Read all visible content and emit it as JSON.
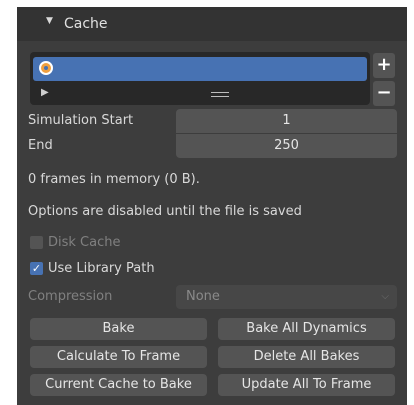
{
  "panel": {
    "title": "Cache",
    "expanded_icon": "▼"
  },
  "cache_list": {
    "selected_item_label": "",
    "item_icon": "point-cache-icon",
    "play_icon": "▶",
    "add_label": "+",
    "remove_label": "−"
  },
  "simulation": {
    "start_label": "Simulation Start",
    "start_value": "1",
    "end_label": "End",
    "end_value": "250"
  },
  "info": {
    "frames_text": "0 frames in memory (0 B).",
    "options_text": "Options are disabled until the file is saved"
  },
  "options": {
    "disk_cache_label": "Disk Cache",
    "disk_cache_checked": false,
    "use_library_path_label": "Use Library Path",
    "use_library_path_checked": true,
    "check_mark": "✓",
    "compression_label": "Compression",
    "compression_value": "None"
  },
  "buttons": {
    "bake": "Bake",
    "bake_all_dynamics": "Bake All Dynamics",
    "calculate_to_frame": "Calculate To Frame",
    "delete_all_bakes": "Delete All Bakes",
    "current_cache_to_bake": "Current Cache to Bake",
    "update_all_to_frame": "Update All To Frame"
  },
  "colors": {
    "panel_bg": "#3d3d3d",
    "header_bg": "#333333",
    "accent": "#4772b3",
    "field_bg": "#545454"
  }
}
